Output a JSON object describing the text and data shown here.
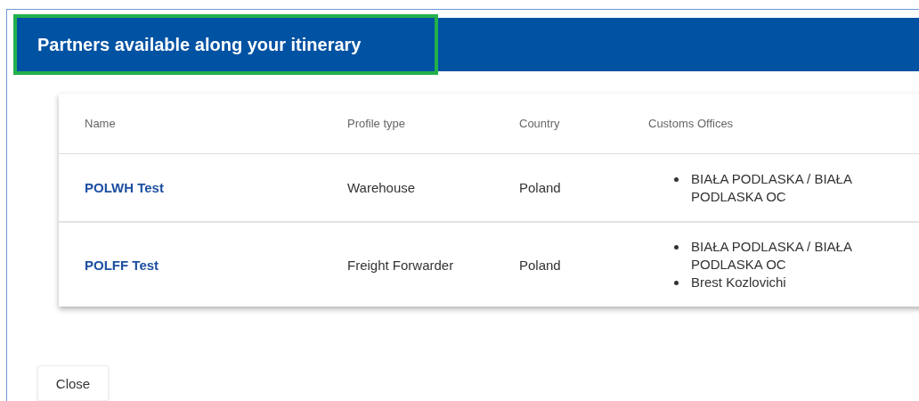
{
  "dialog": {
    "title": "Partners available along your itinerary",
    "title_highlighted": true
  },
  "table": {
    "columns": [
      "Name",
      "Profile type",
      "Country",
      "Customs Offices"
    ],
    "rows": [
      {
        "name": "POLWH Test",
        "profile_type": "Warehouse",
        "country": "Poland",
        "customs_offices": [
          "BIAŁA PODLASKA / BIAŁA PODLASKA OC"
        ]
      },
      {
        "name": "POLFF Test",
        "profile_type": "Freight Forwarder",
        "country": "Poland",
        "customs_offices": [
          "BIAŁA PODLASKA / BIAŁA PODLASKA OC",
          "Brest Kozlovichi"
        ]
      }
    ]
  },
  "buttons": [
    "Close"
  ]
}
